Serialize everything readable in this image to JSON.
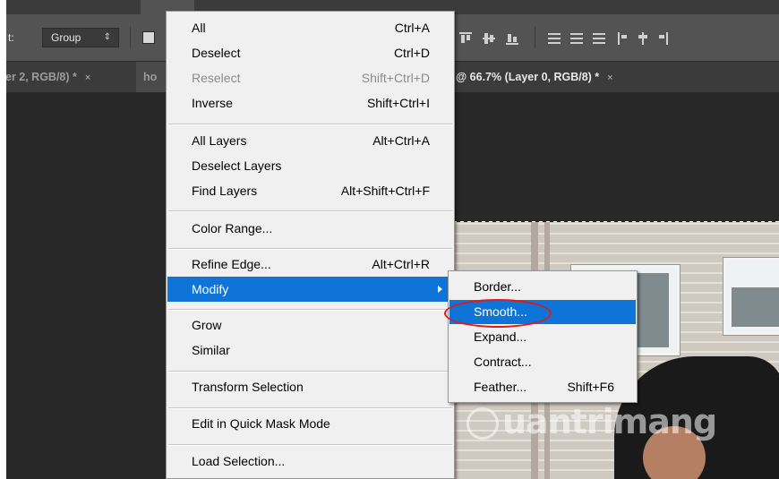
{
  "options_bar": {
    "label": "t:",
    "auto_select_value": "Group",
    "auto_select_arrow": "⇕"
  },
  "tabs": [
    {
      "label": "er 2, RGB/8) *",
      "close": "×"
    },
    {
      "label": "ho",
      "close": ""
    },
    {
      "label": "@ 66.7% (Layer 0, RGB/8) *",
      "close": "×"
    }
  ],
  "select_menu": {
    "items": [
      {
        "label": "All",
        "shortcut": "Ctrl+A",
        "enabled": true
      },
      {
        "label": "Deselect",
        "shortcut": "Ctrl+D",
        "enabled": true
      },
      {
        "label": "Reselect",
        "shortcut": "Shift+Ctrl+D",
        "enabled": false
      },
      {
        "label": "Inverse",
        "shortcut": "Shift+Ctrl+I",
        "enabled": true
      },
      {
        "label": "All Layers",
        "shortcut": "Alt+Ctrl+A",
        "enabled": true
      },
      {
        "label": "Deselect Layers",
        "shortcut": "",
        "enabled": true
      },
      {
        "label": "Find Layers",
        "shortcut": "Alt+Shift+Ctrl+F",
        "enabled": true
      },
      {
        "label": "Color Range...",
        "shortcut": "",
        "enabled": true
      },
      {
        "label": "Refine Edge...",
        "shortcut": "Alt+Ctrl+R",
        "enabled": true
      },
      {
        "label": "Modify",
        "shortcut": "",
        "enabled": true,
        "highlighted": true,
        "has_submenu": true
      },
      {
        "label": "Grow",
        "shortcut": "",
        "enabled": true
      },
      {
        "label": "Similar",
        "shortcut": "",
        "enabled": true
      },
      {
        "label": "Transform Selection",
        "shortcut": "",
        "enabled": true
      },
      {
        "label": "Edit in Quick Mask Mode",
        "shortcut": "",
        "enabled": true
      },
      {
        "label": "Load Selection...",
        "shortcut": "",
        "enabled": true
      }
    ]
  },
  "modify_submenu": {
    "items": [
      {
        "label": "Border...",
        "shortcut": ""
      },
      {
        "label": "Smooth...",
        "shortcut": "",
        "highlighted": true,
        "circled": true
      },
      {
        "label": "Expand...",
        "shortcut": ""
      },
      {
        "label": "Contract...",
        "shortcut": ""
      },
      {
        "label": "Feather...",
        "shortcut": "Shift+F6"
      }
    ]
  },
  "watermark": {
    "text": "uantrimang"
  },
  "colors": {
    "highlight": "#0f74d7",
    "annotation_circle": "#e01a1a",
    "panel_dark": "#282828",
    "options_bar": "#535353"
  }
}
